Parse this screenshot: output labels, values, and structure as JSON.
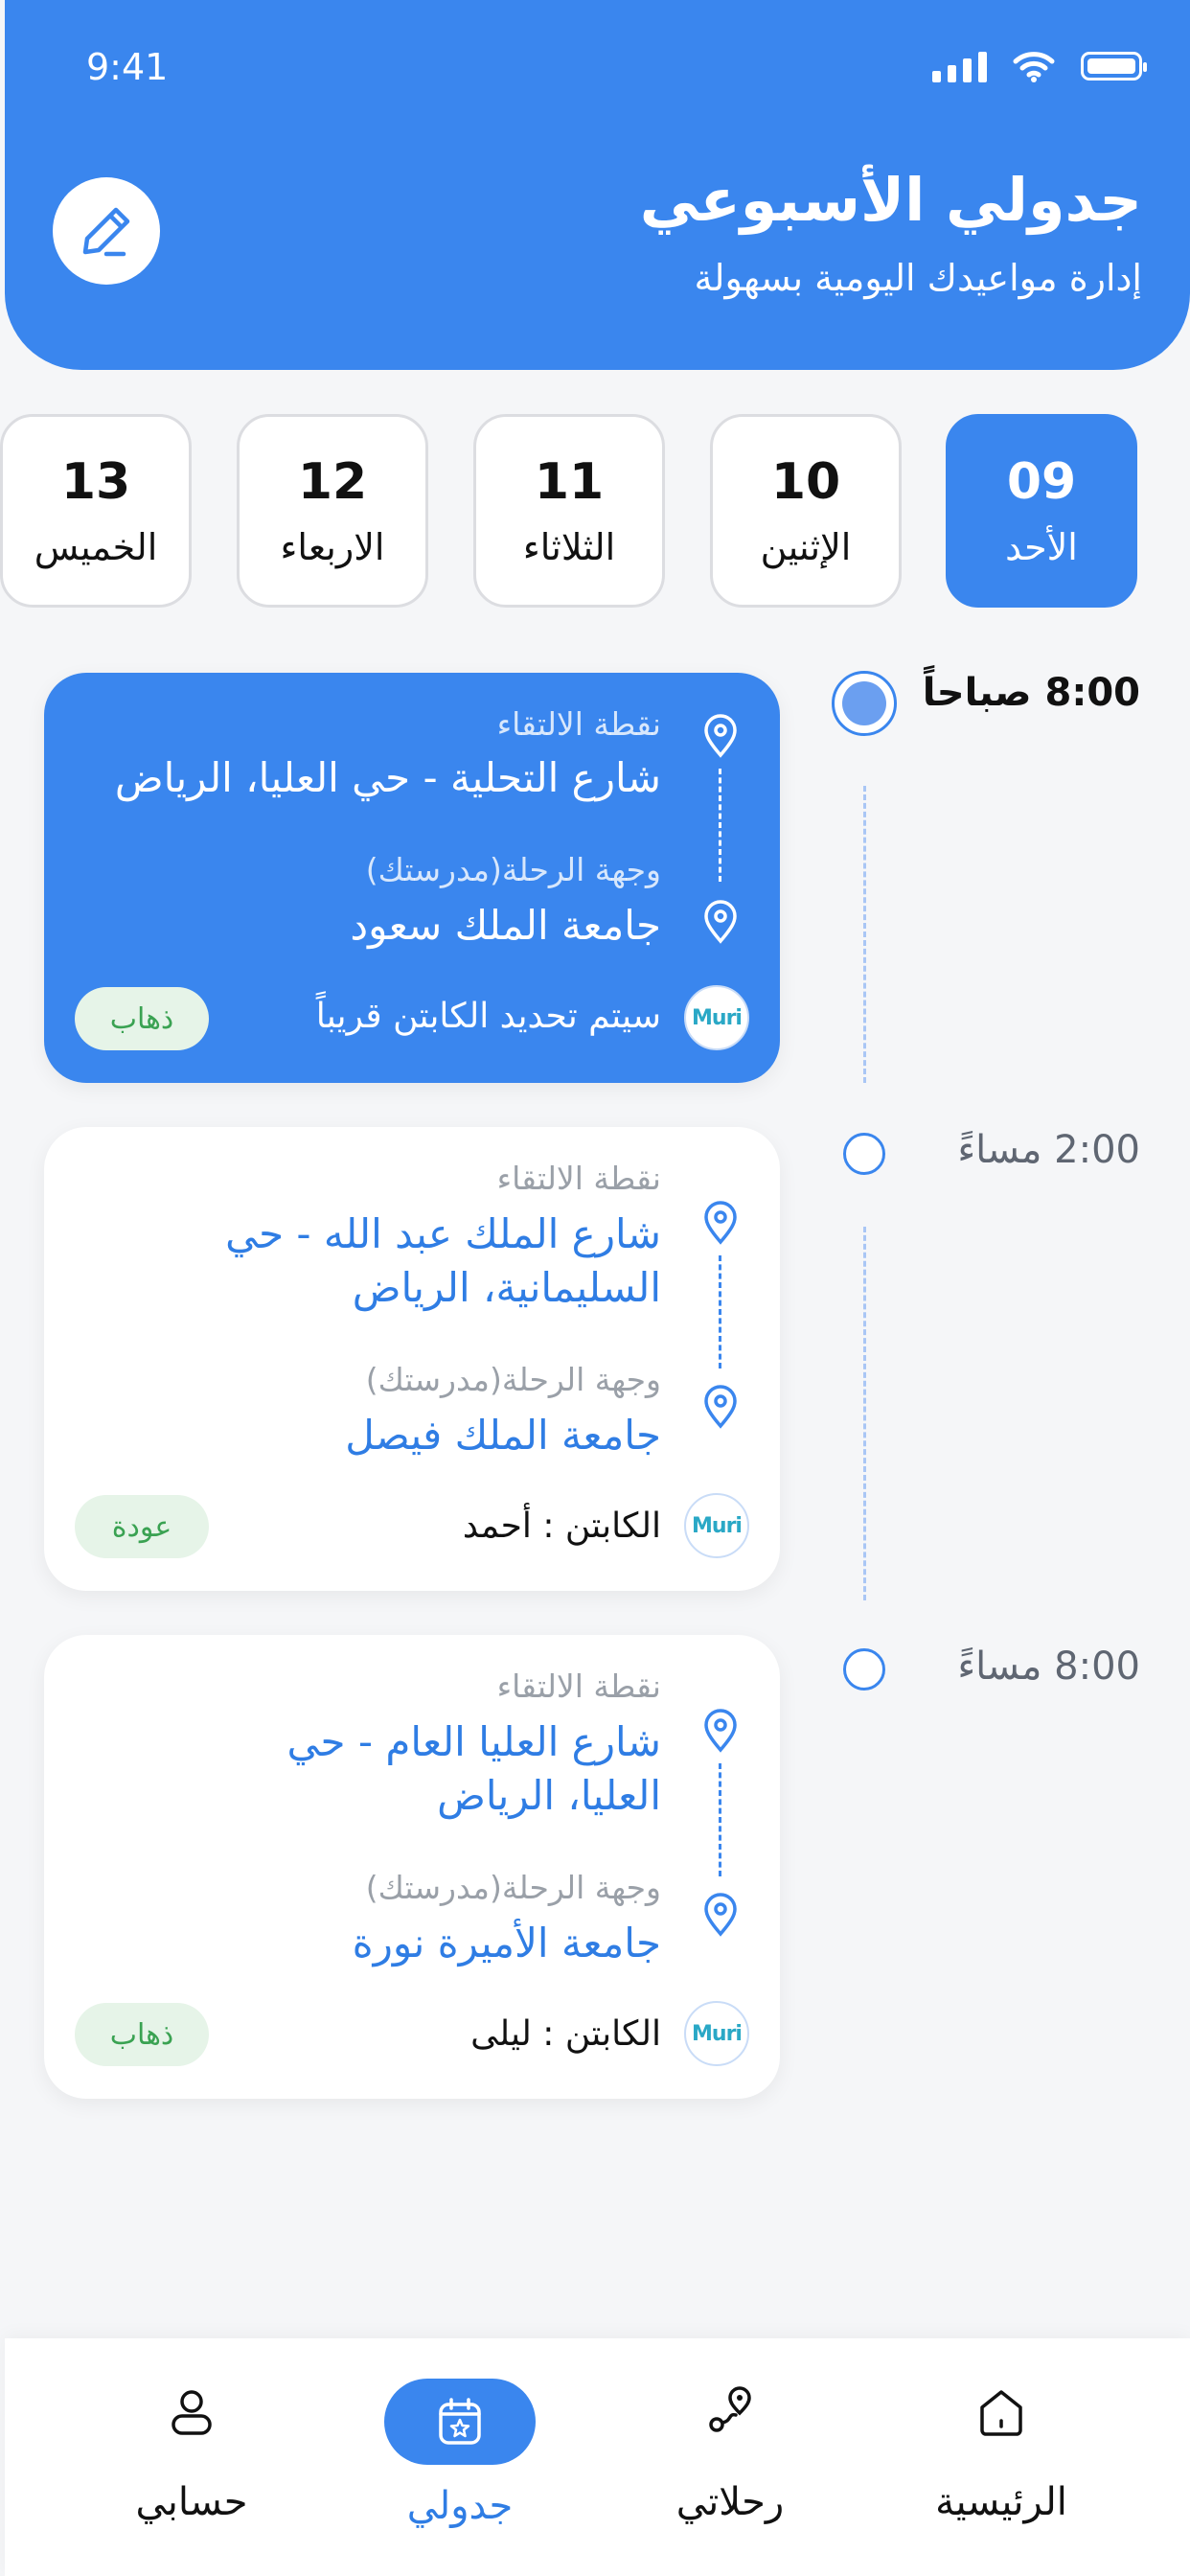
{
  "status_bar": {
    "time": "9:41"
  },
  "header": {
    "title": "جدولي الأسبوعي",
    "subtitle": "إدارة مواعيدك اليومية بسهولة",
    "edit_icon": "pencil-icon"
  },
  "days": [
    {
      "num": "09",
      "name": "الأحد",
      "active": true
    },
    {
      "num": "10",
      "name": "الإثنين",
      "active": false
    },
    {
      "num": "11",
      "name": "الثلاثاء",
      "active": false
    },
    {
      "num": "12",
      "name": "الاربعاء",
      "active": false
    },
    {
      "num": "13",
      "name": "الخميس",
      "active": false
    }
  ],
  "trips": [
    {
      "time": "8:00 صباحاً",
      "pickup_label": "نقطة الالتقاء",
      "pickup": "شارع التحلية - حي العليا، الرياض",
      "dest_label": "وجهة الرحلة(مدرستك)",
      "dest": "جامعة الملك سعود",
      "captain": "سيتم تحديد الكابتن قريباً",
      "badge": "ذهاب",
      "logo": "Muri"
    },
    {
      "time": "2:00 مساءً",
      "pickup_label": "نقطة الالتقاء",
      "pickup": "شارع الملك عبد الله - حي السليمانية، الرياض",
      "dest_label": "وجهة الرحلة(مدرستك)",
      "dest": "جامعة الملك فيصل",
      "captain": "الكابتن : أحمد",
      "badge": "عودة",
      "logo": "Muri"
    },
    {
      "time": "8:00 مساءً",
      "pickup_label": "نقطة الالتقاء",
      "pickup": "شارع العليا العام - حي العليا، الرياض",
      "dest_label": "وجهة الرحلة(مدرستك)",
      "dest": "جامعة الأميرة نورة",
      "captain": "الكابتن : ليلى",
      "badge": "ذهاب",
      "logo": "Muri"
    }
  ],
  "nav": {
    "account": "حسابي",
    "schedule": "جدولي",
    "trips": "رحلاتي",
    "home": "الرئيسية"
  },
  "colors": {
    "primary": "#3a86ee",
    "badge_bg": "#e6f4e8",
    "badge_text": "#3aa252"
  }
}
